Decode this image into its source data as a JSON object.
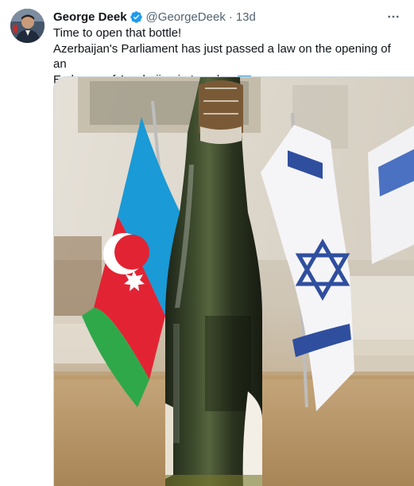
{
  "tweet": {
    "author_name": "George Deek",
    "author_handle": "@GeorgeDeek",
    "separator": "·",
    "time_ago": "13d",
    "lines": [
      "Time to open that bottle!",
      "Azerbaijan's Parliament has just passed a law on the opening of an",
      "Embassy of Azerbaijan in Israel"
    ],
    "emoji_flags": [
      "israel-flag-icon",
      "azerbaijan-flag-icon"
    ]
  },
  "icons": {
    "verified": "verified-badge-icon",
    "more": "more-horizontal-icon"
  },
  "colors": {
    "verified_blue": "#1d9bf0",
    "secondary_text": "#536471",
    "border": "#cfd9de"
  }
}
